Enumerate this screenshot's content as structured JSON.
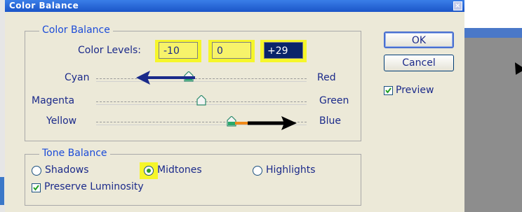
{
  "window": {
    "title": "Color Balance",
    "close_glyph": "×"
  },
  "color_balance": {
    "group_label": "Color Balance",
    "levels_label": "Color Levels:",
    "levels": [
      "-10",
      "0",
      "+29"
    ],
    "sliders": [
      {
        "left": "Cyan",
        "right": "Red",
        "value": -10
      },
      {
        "left": "Magenta",
        "right": "Green",
        "value": 0
      },
      {
        "left": "Yellow",
        "right": "Blue",
        "value": 29
      }
    ]
  },
  "tone_balance": {
    "group_label": "Tone Balance",
    "options": [
      "Shadows",
      "Midtones",
      "Highlights"
    ],
    "selected": "Midtones",
    "preserve_label": "Preserve Luminosity",
    "preserve_checked": true
  },
  "buttons": {
    "ok": "OK",
    "cancel": "Cancel"
  },
  "preview": {
    "label": "Preview",
    "checked": true
  },
  "annotations": {
    "highlight_color": "#f6f62a",
    "arrow_blue": "#1a2a8a",
    "arrow_black": "#000000"
  }
}
